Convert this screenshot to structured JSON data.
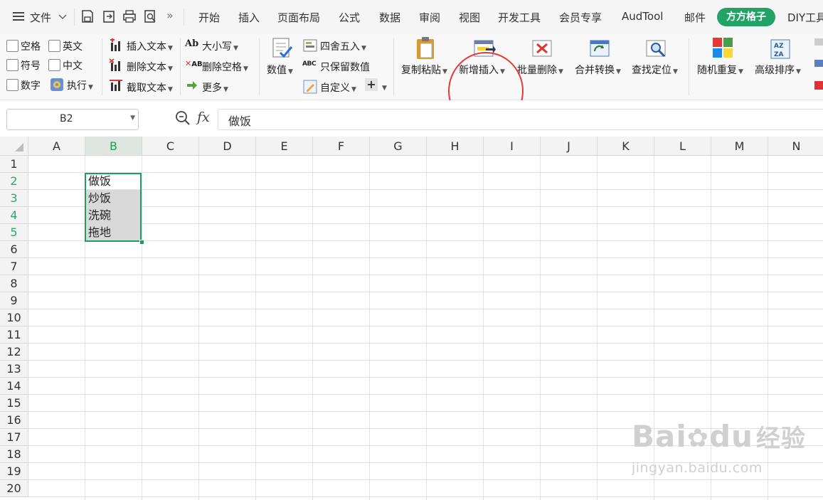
{
  "menubar": {
    "file_label": "文件",
    "tabs": [
      "开始",
      "插入",
      "页面布局",
      "公式",
      "数据",
      "审阅",
      "视图",
      "开发工具",
      "会员专享",
      "AudTool",
      "邮件"
    ],
    "active_tab": "方方格子",
    "trailing_tab": "DIY工具"
  },
  "ribbon": {
    "checkboxes": [
      "空格",
      "英文",
      "符号",
      "中文",
      "数字"
    ],
    "execute_label": "执行",
    "text_group": [
      "插入文本",
      "删除文本",
      "截取文本"
    ],
    "case_group": [
      "大小写",
      "删除空格",
      "更多"
    ],
    "value_label": "数值",
    "number_group": [
      "四舍五入",
      "只保留数值",
      "自定义"
    ],
    "big_buttons": [
      "复制粘贴",
      "新增插入",
      "批量删除",
      "合并转换",
      "查找定位",
      "随机重复",
      "高级排序"
    ],
    "case_icon_text": "Ab",
    "space_icon_text": "AB",
    "abc_icon_text": "ABC"
  },
  "formula_bar": {
    "name_box": "B2",
    "fx_label": "fx",
    "content": "做饭"
  },
  "grid": {
    "columns": [
      "A",
      "B",
      "C",
      "D",
      "E",
      "F",
      "G",
      "H",
      "I",
      "J",
      "K",
      "L",
      "M",
      "N"
    ],
    "rows": [
      "1",
      "2",
      "3",
      "4",
      "5",
      "6",
      "7",
      "8",
      "9",
      "10",
      "11",
      "12",
      "13",
      "14",
      "15",
      "16",
      "17",
      "18",
      "19",
      "20"
    ],
    "cells": {
      "B2": "做饭",
      "B3": "炒饭",
      "B4": "洗碗",
      "B5": "拖地"
    }
  },
  "watermark": {
    "brand": "Bai",
    "brand2": "du",
    "cn": "经验",
    "url": "jingyan.baidu.com"
  },
  "colors": {
    "accent": "#21a366",
    "selection": "#1e9e5e",
    "annotation": "#e53935"
  }
}
